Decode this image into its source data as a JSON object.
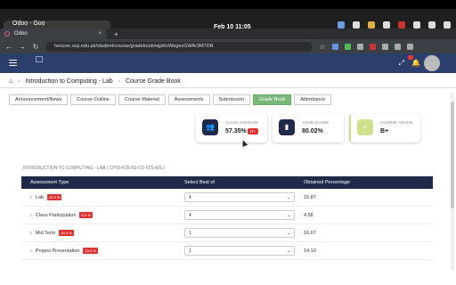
{
  "os": {
    "window_title": "Odoo - Goo",
    "clock": "Feb 10  11:05"
  },
  "browser": {
    "tab_title": "Odoo",
    "url": "horizon.ucp.edu.pk/student/course/gradebook/wjpKnWegezGWAr3M7DR"
  },
  "breadcrumb": {
    "course": "Introduction to Computing - Lab",
    "page": "Course Grade Book"
  },
  "course_tabs": [
    {
      "label": "Announcement/News"
    },
    {
      "label": "Course Outline"
    },
    {
      "label": "Course Material"
    },
    {
      "label": "Assessments"
    },
    {
      "label": "Submission"
    },
    {
      "label": "Grade Book"
    },
    {
      "label": "Attendance"
    }
  ],
  "summary": {
    "class_average_label": "CLASS AVERAGE",
    "class_average": "57.35%",
    "class_average_grade": "D+",
    "your_score_label": "YOUR SCORE",
    "your_score": "80.02%",
    "course_grade_label": "COURSE GRADE",
    "course_grade": "B+"
  },
  "section_title": "INTRODUCTION TO COMPUTING - LAB ( CP10-F25-B3-CS-F25-A/S )",
  "table": {
    "headers": [
      "Assessment Type",
      "Select Best of",
      "Obtained Percentage"
    ],
    "rows": [
      {
        "name": "Lab",
        "weight": "30.0 %",
        "best_of": "4",
        "percentage": "15.87"
      },
      {
        "name": "Class Participation",
        "weight": "5.0 %",
        "best_of": "4",
        "percentage": "4.58"
      },
      {
        "name": "Mid Term",
        "weight": "20.0 %",
        "best_of": "1",
        "percentage": "16.67"
      },
      {
        "name": "Project Presentation",
        "weight": "15.0 %",
        "best_of": "1",
        "percentage": "14.10"
      }
    ]
  },
  "colors": {
    "appbar": "#2c3e6b",
    "active_tab": "#7ab87a",
    "table_header": "#1f2a4a",
    "weight_pill": "#d33333",
    "class_average_icon": "#1f2a4a",
    "your_score_icon": "#1f2a4a",
    "course_grade_icon": "#cfe08a"
  }
}
